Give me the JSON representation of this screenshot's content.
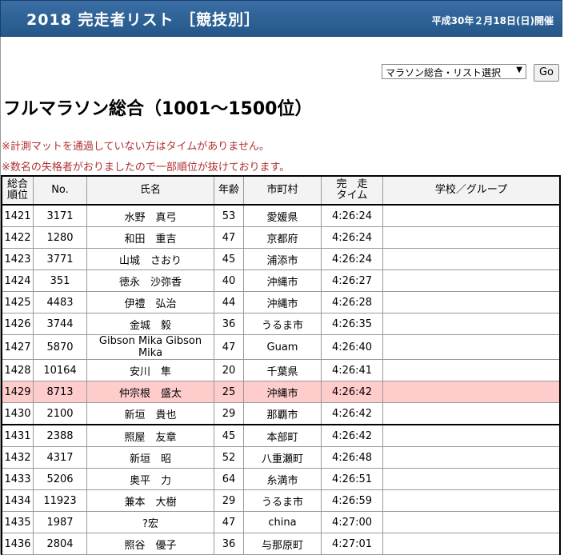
{
  "header": {
    "title": "2018 完走者リスト ［競技別］",
    "date": "平成30年２月18日(日)開催"
  },
  "controls": {
    "select_value": "マラソン総合・リスト選択",
    "go_label": "Go"
  },
  "page_title": "フルマラソン総合（1001～1500位）",
  "notices": [
    "※計測マットを通過していない方はタイムがありません。",
    "※数名の失格者がおりましたので一部順位が抜けております。"
  ],
  "table": {
    "headers": {
      "rank_1": "総合",
      "rank_2": "順位",
      "no": "No.",
      "name": "氏名",
      "age": "年齢",
      "city": "市町村",
      "time_1": "完　走",
      "time_2": "タイム",
      "group": "学校／グループ"
    },
    "rows": [
      {
        "rank": "1421",
        "no": "3171",
        "name": "水野　真弓",
        "age": "53",
        "city": "愛媛県",
        "time": "4:26:24",
        "group": ""
      },
      {
        "rank": "1422",
        "no": "1280",
        "name": "和田　重吉",
        "age": "47",
        "city": "京都府",
        "time": "4:26:24",
        "group": ""
      },
      {
        "rank": "1423",
        "no": "3771",
        "name": "山城　さおり",
        "age": "45",
        "city": "浦添市",
        "time": "4:26:24",
        "group": ""
      },
      {
        "rank": "1424",
        "no": "351",
        "name": "徳永　沙弥香",
        "age": "40",
        "city": "沖縄市",
        "time": "4:26:27",
        "group": ""
      },
      {
        "rank": "1425",
        "no": "4483",
        "name": "伊禮　弘治",
        "age": "44",
        "city": "沖縄市",
        "time": "4:26:28",
        "group": ""
      },
      {
        "rank": "1426",
        "no": "3744",
        "name": "金城　毅",
        "age": "36",
        "city": "うるま市",
        "time": "4:26:35",
        "group": ""
      },
      {
        "rank": "1427",
        "no": "5870",
        "name": "Gibson Mika Gibson Mika",
        "age": "47",
        "city": "Guam",
        "time": "4:26:40",
        "group": ""
      },
      {
        "rank": "1428",
        "no": "10164",
        "name": "安川　隼",
        "age": "20",
        "city": "千葉県",
        "time": "4:26:41",
        "group": ""
      },
      {
        "rank": "1429",
        "no": "8713",
        "name": "仲宗根　盛太",
        "age": "25",
        "city": "沖縄市",
        "time": "4:26:42",
        "group": ""
      },
      {
        "rank": "1430",
        "no": "2100",
        "name": "新垣　貴也",
        "age": "29",
        "city": "那覇市",
        "time": "4:26:42",
        "group": ""
      },
      {
        "rank": "1431",
        "no": "2388",
        "name": "照屋　友章",
        "age": "45",
        "city": "本部町",
        "time": "4:26:42",
        "group": ""
      },
      {
        "rank": "1432",
        "no": "4317",
        "name": "新垣　昭",
        "age": "52",
        "city": "八重瀬町",
        "time": "4:26:48",
        "group": ""
      },
      {
        "rank": "1433",
        "no": "5206",
        "name": "奥平　力",
        "age": "64",
        "city": "糸満市",
        "time": "4:26:51",
        "group": ""
      },
      {
        "rank": "1434",
        "no": "11923",
        "name": "兼本　大樹",
        "age": "29",
        "city": "うるま市",
        "time": "4:26:59",
        "group": ""
      },
      {
        "rank": "1435",
        "no": "1987",
        "name": "?宏",
        "age": "47",
        "city": "china",
        "time": "4:27:00",
        "group": ""
      },
      {
        "rank": "1436",
        "no": "2804",
        "name": "照谷　優子",
        "age": "36",
        "city": "与那原町",
        "time": "4:27:01",
        "group": ""
      }
    ]
  },
  "colors": {
    "header_bg": "#2f6499",
    "highlight_row": "#ffcccc",
    "notice_text": "#b03030"
  }
}
